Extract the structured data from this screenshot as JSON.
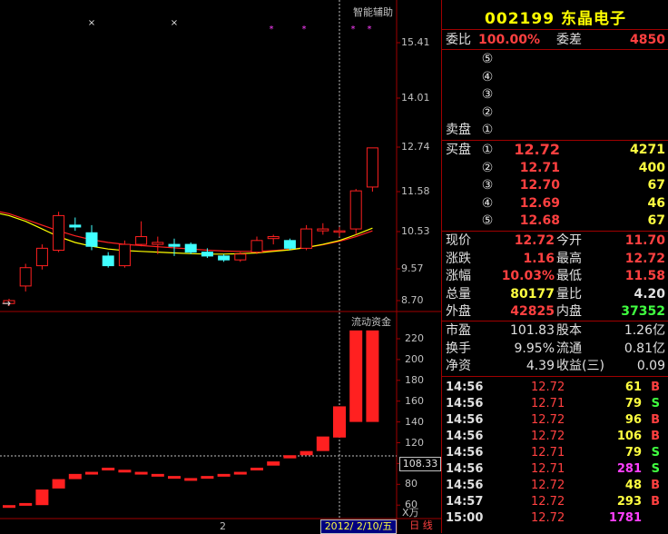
{
  "stock": {
    "code": "002199",
    "name": "东晶电子"
  },
  "colors": {
    "up": "#ff2020",
    "down": "#40ffff",
    "frame": "#a00000",
    "ma1": "#ffff00",
    "ma2": "#ff2020"
  },
  "chart": {
    "indicator_label": "智能辅助",
    "volume_label": "流动资金",
    "price_axis": [
      "15.41",
      "14.01",
      "12.74",
      "11.58",
      "10.53",
      "9.57",
      "8.70"
    ],
    "flow_axis": [
      "220",
      "200",
      "180",
      "160",
      "140",
      "120",
      "100",
      "80",
      "60"
    ],
    "flow_unit": "X万",
    "current_flow": "108.33",
    "bottom_number": "2",
    "date_label": "2012/ 2/10/五",
    "period_label": "日 线"
  },
  "chart_data": {
    "type": "candlestick",
    "candles": [
      {
        "o": 8.62,
        "h": 8.75,
        "l": 8.55,
        "c": 8.7
      },
      {
        "o": 9.1,
        "h": 9.7,
        "l": 8.95,
        "c": 9.6
      },
      {
        "o": 9.65,
        "h": 10.2,
        "l": 9.55,
        "c": 10.1
      },
      {
        "o": 10.05,
        "h": 11.05,
        "l": 10.0,
        "c": 10.95
      },
      {
        "o": 10.7,
        "h": 10.9,
        "l": 10.55,
        "c": 10.65
      },
      {
        "o": 10.5,
        "h": 10.7,
        "l": 10.05,
        "c": 10.15
      },
      {
        "o": 9.9,
        "h": 10.0,
        "l": 9.6,
        "c": 9.65
      },
      {
        "o": 9.65,
        "h": 10.3,
        "l": 9.6,
        "c": 10.2
      },
      {
        "o": 10.2,
        "h": 10.8,
        "l": 10.15,
        "c": 10.4
      },
      {
        "o": 10.2,
        "h": 10.4,
        "l": 9.95,
        "c": 10.25
      },
      {
        "o": 10.2,
        "h": 10.35,
        "l": 9.9,
        "c": 10.15
      },
      {
        "o": 10.2,
        "h": 10.25,
        "l": 9.95,
        "c": 10.0
      },
      {
        "o": 10.0,
        "h": 10.1,
        "l": 9.85,
        "c": 9.9
      },
      {
        "o": 9.9,
        "h": 9.95,
        "l": 9.75,
        "c": 9.8
      },
      {
        "o": 9.8,
        "h": 10.0,
        "l": 9.75,
        "c": 9.95
      },
      {
        "o": 10.0,
        "h": 10.4,
        "l": 9.95,
        "c": 10.3
      },
      {
        "o": 10.35,
        "h": 10.45,
        "l": 10.2,
        "c": 10.4
      },
      {
        "o": 10.3,
        "h": 10.35,
        "l": 10.05,
        "c": 10.1
      },
      {
        "o": 10.1,
        "h": 10.7,
        "l": 10.05,
        "c": 10.6
      },
      {
        "o": 10.55,
        "h": 10.75,
        "l": 10.45,
        "c": 10.6
      },
      {
        "o": 10.55,
        "h": 10.65,
        "l": 10.4,
        "c": 10.55
      },
      {
        "o": 10.6,
        "h": 11.65,
        "l": 10.45,
        "c": 11.6
      },
      {
        "o": 11.7,
        "h": 12.72,
        "l": 11.58,
        "c": 12.72
      }
    ],
    "ma_yellow": [
      10.95,
      10.8,
      10.6,
      10.4,
      10.25,
      10.15,
      10.08,
      10.04,
      10.02,
      10.0,
      9.98,
      9.96,
      9.95,
      9.95,
      9.96,
      9.98,
      10.02,
      10.06,
      10.12,
      10.2,
      10.3,
      10.45,
      10.62
    ],
    "ma_red": [
      11.0,
      10.85,
      10.7,
      10.55,
      10.42,
      10.32,
      10.25,
      10.2,
      10.17,
      10.14,
      10.11,
      10.08,
      10.05,
      10.03,
      10.02,
      10.02,
      10.04,
      10.07,
      10.12,
      10.19,
      10.28,
      10.4,
      10.55
    ],
    "flow": [
      60,
      62,
      75,
      85,
      90,
      92,
      96,
      94,
      92,
      90,
      88,
      86,
      88,
      90,
      92,
      96,
      102,
      108,
      112,
      126,
      155,
      228,
      228
    ],
    "flow_prev": [
      60,
      62,
      60,
      76,
      85,
      92,
      95,
      92,
      90,
      88,
      86,
      85,
      87,
      89,
      91,
      94,
      98,
      105,
      108,
      112,
      125,
      140,
      140
    ]
  },
  "quote": {
    "weibi_label": "委比",
    "weibi": "100.00%",
    "weicha_label": "委差",
    "weicha": "4850",
    "sell_label": "卖盘",
    "buy_label": "买盘",
    "sell_levels": [
      "⑤",
      "④",
      "③",
      "②",
      "①"
    ],
    "buy": [
      {
        "lvl": "①",
        "price": "12.72",
        "vol": "4271"
      },
      {
        "lvl": "②",
        "price": "12.71",
        "vol": "400"
      },
      {
        "lvl": "③",
        "price": "12.70",
        "vol": "67"
      },
      {
        "lvl": "④",
        "price": "12.69",
        "vol": "46"
      },
      {
        "lvl": "⑤",
        "price": "12.68",
        "vol": "67"
      }
    ],
    "stats": [
      {
        "l1": "现价",
        "v1": "12.72",
        "c1": "red",
        "l2": "今开",
        "v2": "11.70",
        "c2": "red"
      },
      {
        "l1": "涨跌",
        "v1": "1.16",
        "c1": "red",
        "l2": "最高",
        "v2": "12.72",
        "c2": "red"
      },
      {
        "l1": "涨幅",
        "v1": "10.03%",
        "c1": "red",
        "l2": "最低",
        "v2": "11.58",
        "c2": "red"
      },
      {
        "l1": "总量",
        "v1": "80177",
        "c1": "yel",
        "l2": "量比",
        "v2": "4.20",
        "c2": "wht"
      },
      {
        "l1": "外盘",
        "v1": "42825",
        "c1": "red",
        "l2": "内盘",
        "v2": "37352",
        "c2": "grn"
      }
    ],
    "fund": [
      {
        "l1": "市盈",
        "v1": "101.83",
        "l2": "股本",
        "v2": "1.26亿"
      },
      {
        "l1": "换手",
        "v1": "9.95%",
        "l2": "流通",
        "v2": "0.81亿"
      },
      {
        "l1": "净资",
        "v1": "4.39",
        "l2": "收益(三)",
        "v2": "0.09"
      }
    ],
    "ticks": [
      {
        "t": "14:56",
        "p": "12.72",
        "v": "61",
        "s": "B"
      },
      {
        "t": "14:56",
        "p": "12.71",
        "v": "79",
        "s": "S"
      },
      {
        "t": "14:56",
        "p": "12.72",
        "v": "96",
        "s": "B"
      },
      {
        "t": "14:56",
        "p": "12.72",
        "v": "106",
        "s": "B"
      },
      {
        "t": "14:56",
        "p": "12.71",
        "v": "79",
        "s": "S"
      },
      {
        "t": "14:56",
        "p": "12.71",
        "v": "281",
        "s": "S"
      },
      {
        "t": "14:56",
        "p": "12.72",
        "v": "48",
        "s": "B"
      },
      {
        "t": "14:57",
        "p": "12.72",
        "v": "293",
        "s": "B"
      },
      {
        "t": "15:00",
        "p": "12.72",
        "v": "1781",
        "s": ""
      }
    ]
  }
}
